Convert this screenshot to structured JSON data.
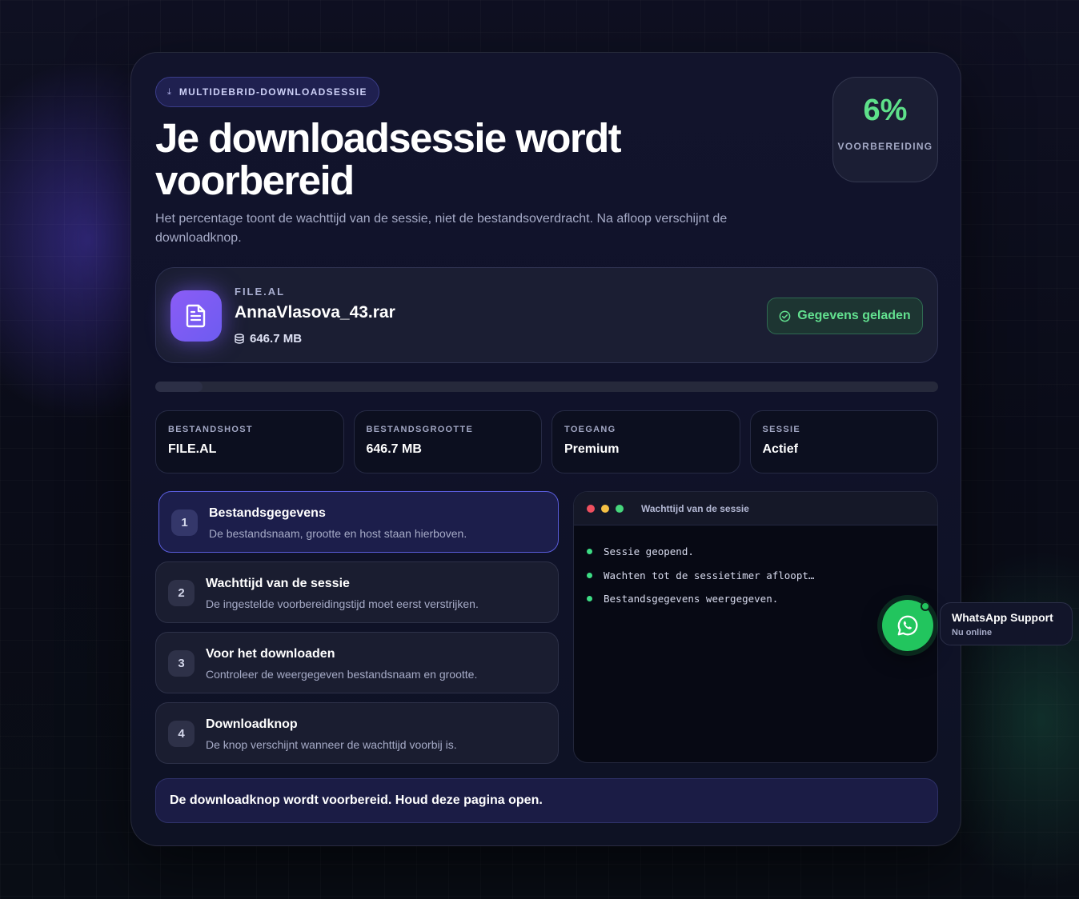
{
  "badge": {
    "icon": "download-icon",
    "label": "MULTIDEBRID-DOWNLOADSESSIE"
  },
  "title": "Je downloadsessie wordt voorbereid",
  "subtitle": "Het percentage toont de wachttijd van de sessie, niet de bestandsoverdracht. Na afloop verschijnt de downloadknop.",
  "progress": {
    "percent_text": "6%",
    "label": "VOORBEREIDING",
    "fraction": 0.06
  },
  "file": {
    "host": "FILE.AL",
    "name": "AnnaVlasova_43.rar",
    "size": "646.7 MB",
    "status_label": "Gegevens geladen",
    "icon": "document-icon"
  },
  "stats": [
    {
      "key": "BESTANDSHOST",
      "value": "FILE.AL"
    },
    {
      "key": "BESTANDSGROOTTE",
      "value": "646.7 MB"
    },
    {
      "key": "TOEGANG",
      "value": "Premium"
    },
    {
      "key": "SESSIE",
      "value": "Actief"
    }
  ],
  "steps": [
    {
      "num": "1",
      "title": "Bestandsgegevens",
      "desc": "De bestandsnaam, grootte en host staan hierboven."
    },
    {
      "num": "2",
      "title": "Wachttijd van de sessie",
      "desc": "De ingestelde voorbereidingstijd moet eerst verstrijken."
    },
    {
      "num": "3",
      "title": "Voor het downloaden",
      "desc": "Controleer de weergegeven bestandsnaam en grootte."
    },
    {
      "num": "4",
      "title": "Downloadknop",
      "desc": "De knop verschijnt wanneer de wachttijd voorbij is."
    }
  ],
  "terminal": {
    "title": "Wachttijd van de sessie",
    "lines": [
      "Sessie geopend.",
      "Wachten tot de sessietimer afloopt…",
      "Bestandsgegevens weergegeven."
    ]
  },
  "notice": "De downloadknop wordt voorbereid. Houd deze pagina open.",
  "whatsapp": {
    "title": "WhatsApp Support",
    "status": "Nu online",
    "icon": "whatsapp-icon"
  },
  "colors": {
    "accent": "#6d5cf0",
    "success": "#5ee08a",
    "whatsapp": "#22c55e"
  }
}
